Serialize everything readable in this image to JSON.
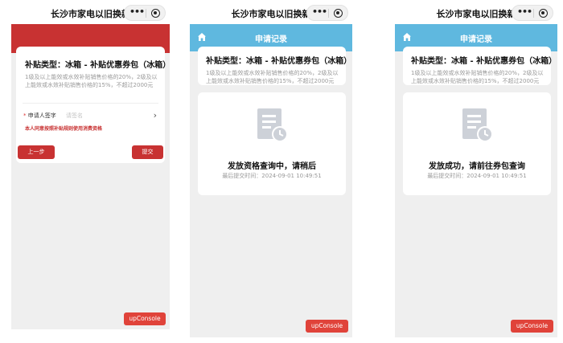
{
  "app_title": "长沙市家电以旧换新",
  "capsule": {
    "more_glyph": "•••"
  },
  "subsidy": {
    "type_line": "补贴类型：冰箱 - 补贴优惠券包（冰箱）",
    "description": "1级及以上能效或水效补贴销售价格的20%，2级及以上能效或水效补贴销售价格的15%，不超过2000元"
  },
  "screen1": {
    "applicant_label": "申请人签字",
    "required_mark": "*",
    "applicant_placeholder": "请签名",
    "chevron": "›",
    "agreement_text": "本人同意按照补贴规则使用消费资格",
    "prev_button": "上一步",
    "submit_button": "提交"
  },
  "request_record": {
    "header": "申请记录"
  },
  "screen2": {
    "status_title": "发放资格查询中，请稍后",
    "submit_time": "最后提交时间：2024-09-01 10:49:51"
  },
  "screen3": {
    "status_title": "发放成功，请前往券包查询",
    "submit_time": "最后提交时间：2024-09-01 10:49:51"
  },
  "console_button": "upConsole",
  "colors": {
    "brand_red": "#c83232",
    "header_blue": "#5fb8df",
    "console_red": "#e0433a",
    "background": "#efefef"
  },
  "icons": [
    "more-icon",
    "close-target-icon",
    "home-icon",
    "document-clock-icon"
  ]
}
